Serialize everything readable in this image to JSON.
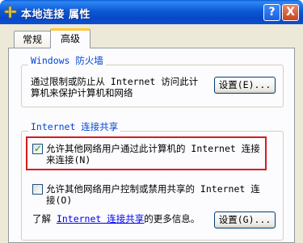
{
  "window": {
    "title": "本地连接 属性",
    "help_label": "?",
    "close_label": "X"
  },
  "tabs": [
    {
      "label": "常规"
    },
    {
      "label": "高级"
    }
  ],
  "firewall": {
    "group_title": "Windows 防火墙",
    "description_line1": "通过限制或防止从 Internet 访问此计",
    "description_line2": "算机来保护计算机和网络",
    "settings_button": "设置(E)..."
  },
  "ics": {
    "group_title": "Internet 连接共享",
    "allow_share_line1": "允许其他网络用户通过此计算机的 Internet 连接",
    "allow_share_line2": "来连接(N)",
    "allow_share_checked": true,
    "allow_control_line1": "允许其他网络用户控制或禁用共享的 Internet 连",
    "allow_control_line2": "接(O)",
    "allow_control_checked": false,
    "learn_prefix": "了解",
    "learn_link": "Internet 连接共享",
    "learn_suffix": "的更多信息。",
    "settings_button": "设置(G)..."
  }
}
